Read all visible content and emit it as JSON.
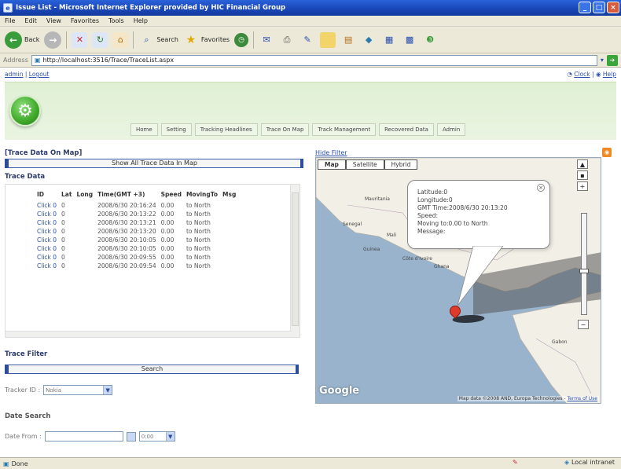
{
  "window": {
    "title": "Issue List - Microsoft Internet Explorer provided by HIC Financial Group"
  },
  "menu": [
    "File",
    "Edit",
    "View",
    "Favorites",
    "Tools",
    "Help"
  ],
  "toolbar": {
    "back_label": "Back",
    "search_label": "Search",
    "favorites_label": "Favorites"
  },
  "address": {
    "label": "Address",
    "url": "http://localhost:3516/Trace/TraceList.aspx"
  },
  "page": {
    "user_links": [
      "admin",
      "Logout"
    ],
    "top_links": [
      "Clock",
      "Help"
    ],
    "nav": [
      "Home",
      "Setting",
      "Tracking Headlines",
      "Trace On Map",
      "Track Management",
      "Recovered Data",
      "Admin"
    ]
  },
  "trace_section": {
    "title": "[Trace Data On Map]",
    "show_all_label": "Show All Trace Data  In Map",
    "trace_data_title": "Trace Data",
    "columns": [
      "ID",
      "Lat",
      "Long",
      "Time(GMT +3)",
      "Speed",
      "MovingTo",
      "Msg"
    ],
    "rows": [
      {
        "id": "Click 0",
        "lat": "0",
        "time": "2008/6/30 20:16:24",
        "speed": "0.00",
        "moving": "to North"
      },
      {
        "id": "Click 0",
        "lat": "0",
        "time": "2008/6/30 20:13:22",
        "speed": "0.00",
        "moving": "to North"
      },
      {
        "id": "Click 0",
        "lat": "0",
        "time": "2008/6/30 20:13:21",
        "speed": "0.00",
        "moving": "to North"
      },
      {
        "id": "Click 0",
        "lat": "0",
        "time": "2008/6/30 20:13:20",
        "speed": "0.00",
        "moving": "to North"
      },
      {
        "id": "Click 0",
        "lat": "0",
        "time": "2008/6/30 20:10:05",
        "speed": "0.00",
        "moving": "to North"
      },
      {
        "id": "Click 0",
        "lat": "0",
        "time": "2008/6/30 20:10:05",
        "speed": "0.00",
        "moving": "to North"
      },
      {
        "id": "Click 0",
        "lat": "0",
        "time": "2008/6/30 20:09:55",
        "speed": "0.00",
        "moving": "to North"
      },
      {
        "id": "Click 0",
        "lat": "0",
        "time": "2008/6/30 20:09:54",
        "speed": "0.00",
        "moving": "to North"
      }
    ]
  },
  "filter": {
    "title": "Trace Filter",
    "search_label": "Search",
    "tracker_label": "Tracker ID :",
    "tracker_value": "Nokia",
    "date_title": "Date Search",
    "date_from_label": "Date From :",
    "date_from_value": "",
    "time_value": "0:00"
  },
  "map": {
    "hide_filter": "Hide Filter",
    "types": [
      "Map",
      "Satellite",
      "Hybrid"
    ],
    "info": {
      "lines": [
        "Latitude:0",
        "Longitude:0",
        "GMT Time:2008/6/30 20:13:20",
        "Speed:",
        "Moving to:0.00 to North",
        "Message:"
      ]
    },
    "places": [
      "Mauritania",
      "Senegal",
      "Guinea",
      "Mali",
      "Gabon",
      "Côte d'Ivoire",
      "Ghana"
    ],
    "logo": "Google",
    "attribution": "Map data ©2008 AND, Europa Technologies - ",
    "terms": "Terms of Use"
  },
  "status": {
    "text": "Done",
    "zone": "Local intranet"
  },
  "colors": {
    "header_green": "#dff0d4",
    "link_blue": "#2a4eb0",
    "map_sea": "#99b3cc",
    "land": "#f2efe6"
  }
}
